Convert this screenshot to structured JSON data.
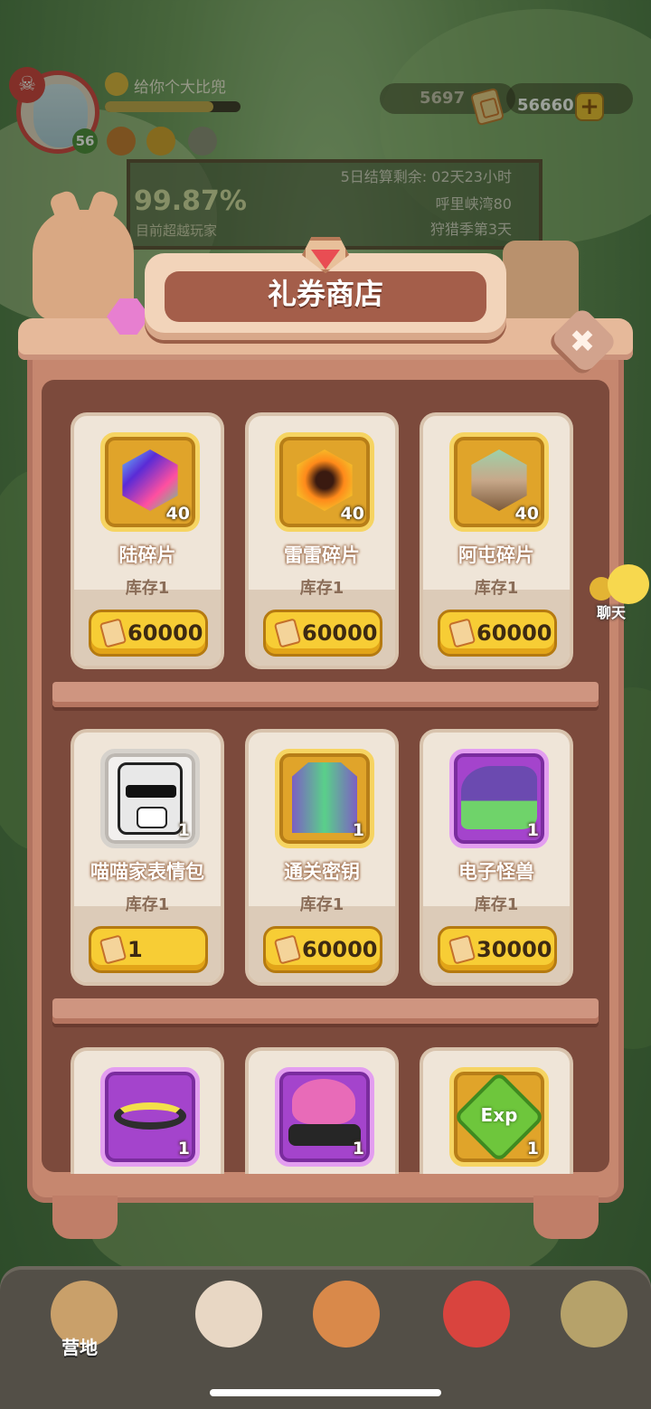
{
  "player": {
    "name": "给你个大比兜",
    "level": "56"
  },
  "resources": {
    "coins": "5697",
    "tickets": "56660"
  },
  "event_board": {
    "countdown": "5日结算剩余: 02天23小时",
    "location": "呼里峡湾80",
    "season": "狩猎季第3天",
    "percent": "99.87%",
    "percent_label": "目前超越玩家"
  },
  "shop": {
    "title": "礼券商店",
    "close_label": "✖",
    "items": [
      {
        "name": "陆碎片",
        "qty": "40",
        "stock": "库存1",
        "price": "60000",
        "frame": "gold",
        "icon": "lu-shard-icon"
      },
      {
        "name": "雷雷碎片",
        "qty": "40",
        "stock": "库存1",
        "price": "60000",
        "frame": "gold",
        "icon": "leilei-shard-icon"
      },
      {
        "name": "阿屯碎片",
        "qty": "40",
        "stock": "库存1",
        "price": "60000",
        "frame": "gold",
        "icon": "atun-shard-icon"
      },
      {
        "name": "喵喵家表情包",
        "qty": "1",
        "stock": "库存1",
        "price": "1",
        "frame": "white",
        "icon": "cat-sticker-icon"
      },
      {
        "name": "通关密钥",
        "qty": "1",
        "stock": "库存1",
        "price": "60000",
        "frame": "gold",
        "icon": "jacket-icon"
      },
      {
        "name": "电子怪兽",
        "qty": "1",
        "stock": "库存1",
        "price": "30000",
        "frame": "purple",
        "icon": "sneaker-icon"
      },
      {
        "name": "",
        "qty": "1",
        "stock": "",
        "price": "",
        "frame": "purple",
        "icon": "visor-icon"
      },
      {
        "name": "",
        "qty": "1",
        "stock": "",
        "price": "",
        "frame": "purple",
        "icon": "hair-goggles-icon"
      },
      {
        "name": "",
        "qty": "1",
        "stock": "",
        "price": "",
        "frame": "gold",
        "icon": "exp-icon"
      }
    ]
  },
  "chat": {
    "label": "聊天"
  },
  "bottom_nav": {
    "camp_label": "营地"
  },
  "colors": {
    "accent": "#f7cd35",
    "cabinet": "#c6876f",
    "purple_frame": "#a444cc"
  }
}
